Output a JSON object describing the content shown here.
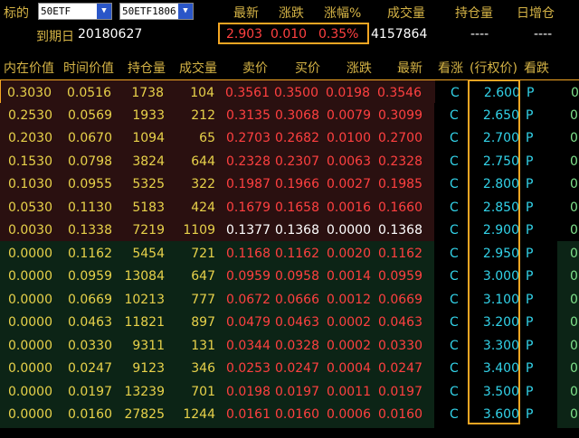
{
  "header": {
    "underlying_label": "标的",
    "underlying_select": "50ETF",
    "contract_select": "50ETF1806",
    "cols": [
      "最新",
      "涨跌",
      "涨幅%",
      "成交量",
      "持仓量",
      "日增仓"
    ],
    "expiry_label": "到期日",
    "expiry_value": "20180627",
    "last": "2.903",
    "change": "0.010",
    "change_pct": "0.35%",
    "volume": "4157864",
    "open_interest": "----",
    "daily_oi_change": "----"
  },
  "table": {
    "columns": [
      "内在价值",
      "时间价值",
      "持仓量",
      "成交量",
      "卖价",
      "买价",
      "涨跌",
      "最新",
      "看涨",
      "(行权价)",
      "看跌"
    ],
    "rows": [
      {
        "intrinsic": "0.3030",
        "time_value": "0.0516",
        "oi": "1738",
        "vol": "104",
        "ask": "0.3561",
        "bid": "0.3500",
        "chg": "0.0198",
        "last": "0.3546",
        "call": "C",
        "strike": "2.600",
        "put": "P",
        "edge": "0"
      },
      {
        "intrinsic": "0.2530",
        "time_value": "0.0569",
        "oi": "1933",
        "vol": "212",
        "ask": "0.3135",
        "bid": "0.3068",
        "chg": "0.0079",
        "last": "0.3099",
        "call": "C",
        "strike": "2.650",
        "put": "P",
        "edge": "0"
      },
      {
        "intrinsic": "0.2030",
        "time_value": "0.0670",
        "oi": "1094",
        "vol": "65",
        "ask": "0.2703",
        "bid": "0.2682",
        "chg": "0.0100",
        "last": "0.2700",
        "call": "C",
        "strike": "2.700",
        "put": "P",
        "edge": "0"
      },
      {
        "intrinsic": "0.1530",
        "time_value": "0.0798",
        "oi": "3824",
        "vol": "644",
        "ask": "0.2328",
        "bid": "0.2307",
        "chg": "0.0063",
        "last": "0.2328",
        "call": "C",
        "strike": "2.750",
        "put": "P",
        "edge": "0"
      },
      {
        "intrinsic": "0.1030",
        "time_value": "0.0955",
        "oi": "5325",
        "vol": "322",
        "ask": "0.1987",
        "bid": "0.1966",
        "chg": "0.0027",
        "last": "0.1985",
        "call": "C",
        "strike": "2.800",
        "put": "P",
        "edge": "0"
      },
      {
        "intrinsic": "0.0530",
        "time_value": "0.1130",
        "oi": "5183",
        "vol": "424",
        "ask": "0.1679",
        "bid": "0.1658",
        "chg": "0.0016",
        "last": "0.1660",
        "call": "C",
        "strike": "2.850",
        "put": "P",
        "edge": "0"
      },
      {
        "intrinsic": "0.0030",
        "time_value": "0.1338",
        "oi": "7219",
        "vol": "1109",
        "ask": "0.1377",
        "bid": "0.1368",
        "chg": "0.0000",
        "last": "0.1368",
        "call": "C",
        "strike": "2.900",
        "put": "P",
        "edge": "0"
      },
      {
        "intrinsic": "0.0000",
        "time_value": "0.1162",
        "oi": "5454",
        "vol": "721",
        "ask": "0.1168",
        "bid": "0.1162",
        "chg": "0.0020",
        "last": "0.1162",
        "call": "C",
        "strike": "2.950",
        "put": "P",
        "edge": "0"
      },
      {
        "intrinsic": "0.0000",
        "time_value": "0.0959",
        "oi": "13084",
        "vol": "647",
        "ask": "0.0959",
        "bid": "0.0958",
        "chg": "0.0014",
        "last": "0.0959",
        "call": "C",
        "strike": "3.000",
        "put": "P",
        "edge": "0"
      },
      {
        "intrinsic": "0.0000",
        "time_value": "0.0669",
        "oi": "10213",
        "vol": "777",
        "ask": "0.0672",
        "bid": "0.0666",
        "chg": "0.0012",
        "last": "0.0669",
        "call": "C",
        "strike": "3.100",
        "put": "P",
        "edge": "0"
      },
      {
        "intrinsic": "0.0000",
        "time_value": "0.0463",
        "oi": "11821",
        "vol": "897",
        "ask": "0.0479",
        "bid": "0.0463",
        "chg": "0.0002",
        "last": "0.0463",
        "call": "C",
        "strike": "3.200",
        "put": "P",
        "edge": "0"
      },
      {
        "intrinsic": "0.0000",
        "time_value": "0.0330",
        "oi": "9311",
        "vol": "131",
        "ask": "0.0344",
        "bid": "0.0328",
        "chg": "0.0002",
        "last": "0.0330",
        "call": "C",
        "strike": "3.300",
        "put": "P",
        "edge": "0"
      },
      {
        "intrinsic": "0.0000",
        "time_value": "0.0247",
        "oi": "9123",
        "vol": "346",
        "ask": "0.0253",
        "bid": "0.0247",
        "chg": "0.0004",
        "last": "0.0247",
        "call": "C",
        "strike": "3.400",
        "put": "P",
        "edge": "0"
      },
      {
        "intrinsic": "0.0000",
        "time_value": "0.0197",
        "oi": "13239",
        "vol": "701",
        "ask": "0.0198",
        "bid": "0.0197",
        "chg": "0.0011",
        "last": "0.0197",
        "call": "C",
        "strike": "3.500",
        "put": "P",
        "edge": "0"
      },
      {
        "intrinsic": "0.0000",
        "time_value": "0.0160",
        "oi": "27825",
        "vol": "1244",
        "ask": "0.0161",
        "bid": "0.0160",
        "chg": "0.0006",
        "last": "0.0160",
        "call": "C",
        "strike": "3.600",
        "put": "P",
        "edge": "0"
      }
    ]
  },
  "colors": {
    "itm_bg": "#2a1010",
    "otm_bg": "#0c2416",
    "highlight": "#f5a623",
    "label": "#d6b446",
    "price_up": "#ff4040",
    "strike": "#32d2e8"
  }
}
